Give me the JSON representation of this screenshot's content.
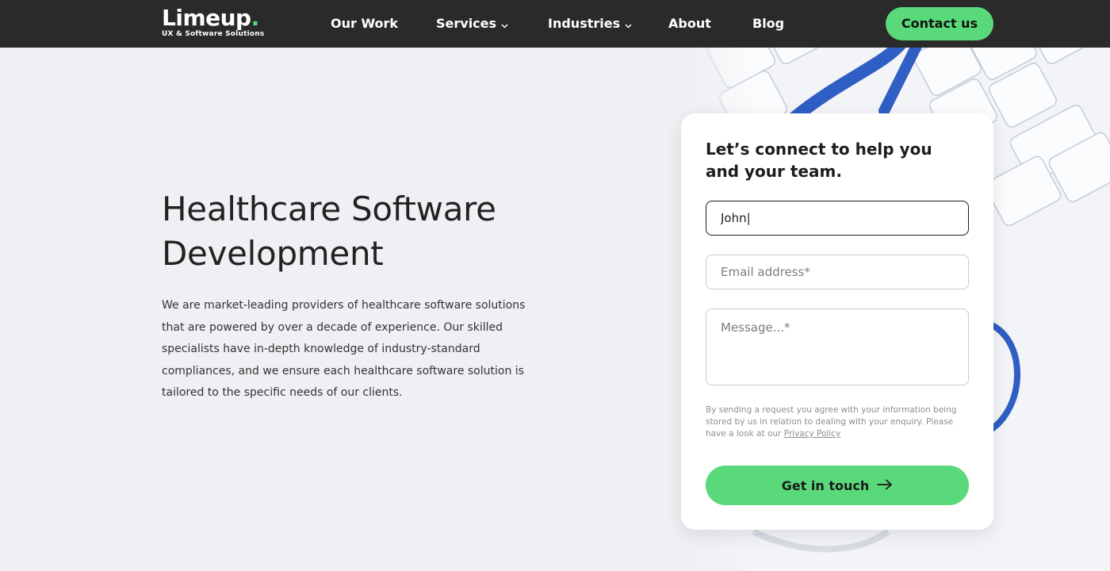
{
  "header": {
    "logo_word": "Limeup",
    "logo_dot": ".",
    "logo_tagline": "UX & Software Solutions",
    "nav": [
      {
        "label": "Our Work",
        "has_dropdown": false
      },
      {
        "label": "Services",
        "has_dropdown": true
      },
      {
        "label": "Industries",
        "has_dropdown": true
      },
      {
        "label": "About",
        "has_dropdown": false
      },
      {
        "label": "Blog",
        "has_dropdown": false
      }
    ],
    "contact_label": "Contact us"
  },
  "hero": {
    "title": "Healthcare Software Development",
    "description": "We are market-leading providers of healthcare software solutions that are powered by over a decade of experience. Our skilled specialists have in-depth knowledge of industry-standard compliances, and we ensure each healthcare software solution is tailored to the specific needs of our clients."
  },
  "form": {
    "title": "Let’s connect to help you and your team.",
    "name_value": "John|",
    "email_placeholder": "Email address*",
    "message_placeholder": "Message...*",
    "consent_text": "By sending a request you agree with your information being stored by us in relation to dealing with your enquiry. Please have a look at our ",
    "privacy_link": "Privacy Policy",
    "submit_label": "Get in touch"
  },
  "icons": {
    "nav_dropdown": "chevron-down-icon",
    "submit": "arrow-right-icon"
  },
  "colors": {
    "accent": "#5ad97a",
    "header_bg": "#2a2a2a",
    "page_bg": "#eef0f3",
    "stethoscope": "#2f5fc4"
  }
}
